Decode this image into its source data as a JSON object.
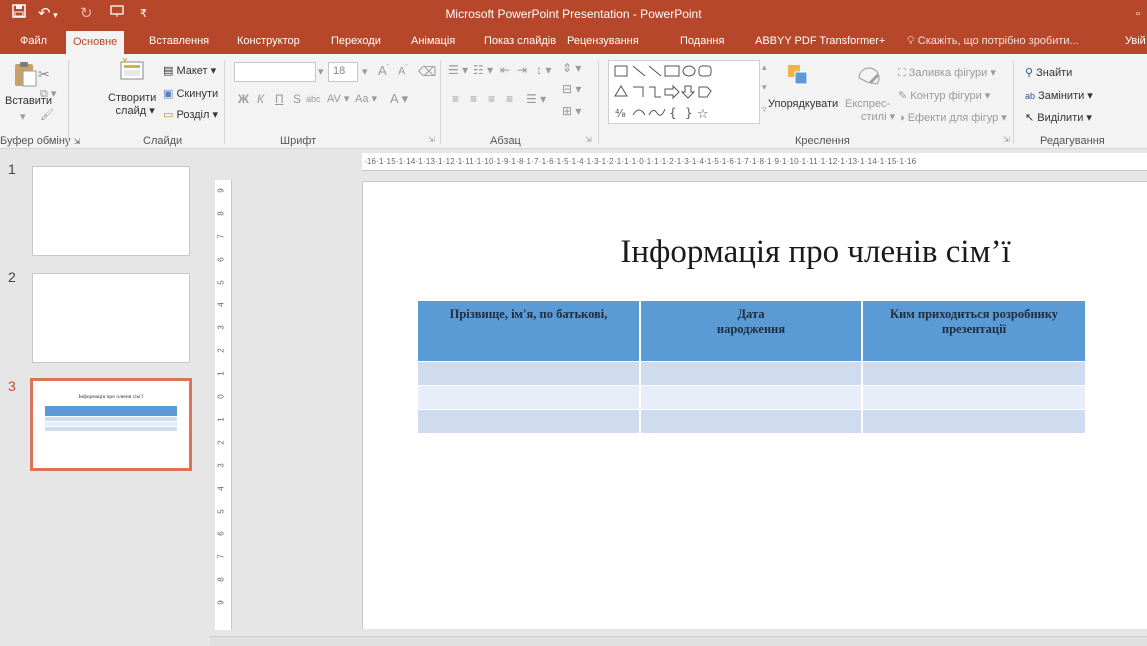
{
  "window": {
    "title": "Microsoft PowerPoint Presentation - PowerPoint"
  },
  "tabs": [
    {
      "label": "Файл"
    },
    {
      "label": "Основне",
      "active": true
    },
    {
      "label": "Вставлення"
    },
    {
      "label": "Конструктор"
    },
    {
      "label": "Переходи"
    },
    {
      "label": "Анімація"
    },
    {
      "label": "Показ слайдів"
    },
    {
      "label": "Рецензування"
    },
    {
      "label": "Подання"
    },
    {
      "label": "ABBYY PDF Transformer+"
    },
    {
      "label": "Скажіть, що потрібно зробити..."
    },
    {
      "label": "Увій"
    }
  ],
  "ribbon": {
    "clipboard": {
      "paste": "Вставити",
      "group": "Буфер обміну"
    },
    "slides": {
      "new_slide_line1": "Створити",
      "new_slide_line2": "слайд",
      "layout": "Макет",
      "reset": "Скинути",
      "section": "Розділ",
      "group": "Слайди"
    },
    "font": {
      "size": "18",
      "bold": "Ж",
      "italic": "К",
      "underline": "П",
      "strike": "S",
      "group": "Шрифт"
    },
    "paragraph": {
      "group": "Абзац"
    },
    "drawing": {
      "arrange": "Упорядкувати",
      "quick_styles_line1": "Експрес-",
      "quick_styles_line2": "стилі",
      "fill": "Заливка фігури",
      "outline": "Контур фігури",
      "effects": "Ефекти для фігур",
      "group": "Креслення"
    },
    "editing": {
      "find": "Знайти",
      "replace": "Замінити",
      "select": "Виділити",
      "group": "Редагування"
    }
  },
  "thumbnails": [
    {
      "number": "1",
      "selected": false
    },
    {
      "number": "2",
      "selected": false
    },
    {
      "number": "3",
      "selected": true,
      "title": "Інформація про членів сім’ї"
    }
  ],
  "ruler": {
    "horizontal": "·16·1·15·1·14·1·13·1·12·1·11·1·10·1·9·1·8·1·7·1·6·1·5·1·4·1·3·1·2·1·1·1·0·1·1·1·2·1·3·1·4·1·5·1·6·1·7·1·8·1·9·1·10·1·11·1·12·1·13·1·14·1·15·1·16",
    "vertical": [
      "9",
      "8",
      "7",
      "6",
      "5",
      "4",
      "3",
      "2",
      "1",
      "0",
      "1",
      "2",
      "3",
      "4",
      "5",
      "6",
      "7",
      "8",
      "9"
    ]
  },
  "slide": {
    "title": "Інформація про членів сім’ї",
    "table": {
      "headers": [
        "Прізвище, ім'я, по батькові,",
        "Дата\nнародження",
        "Ким приходиться розробнику презентації"
      ],
      "rows": [
        [
          "",
          "",
          ""
        ],
        [
          "",
          "",
          ""
        ],
        [
          "",
          "",
          ""
        ]
      ]
    }
  },
  "colors": {
    "accent": "#b7472a",
    "table_header": "#5b9bd5",
    "row_dark": "#cfdcef",
    "row_light": "#e8eef7",
    "thumb_selected": "#e0725a"
  }
}
